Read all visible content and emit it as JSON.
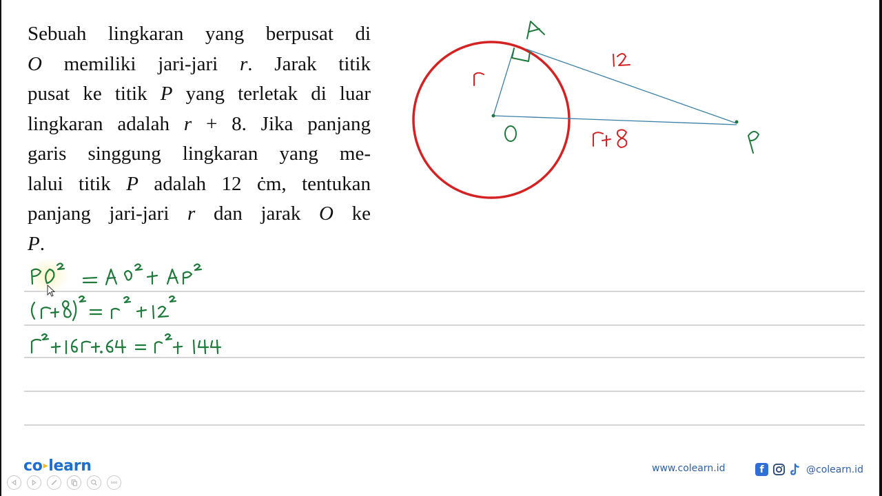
{
  "problem": {
    "lines": [
      "Sebuah lingkaran yang berpusat di",
      [
        "O",
        " memiliki jari-jari ",
        "r",
        ". Jarak titik"
      ],
      [
        "pusat ke titik ",
        "P",
        " yang terletak di luar"
      ],
      [
        "lingkaran adalah ",
        "r",
        " + 8. Jika panjang"
      ],
      "garis singgung lingkaran yang me-",
      [
        "lalui titik ",
        "P",
        " adalah 12 ċm, tentukan"
      ],
      [
        "panjang jari-jari ",
        "r",
        " dan jarak ",
        "O",
        " ke"
      ],
      [
        "P",
        "."
      ]
    ]
  },
  "diagram": {
    "points": {
      "A": "A",
      "O": "O",
      "P": "P"
    },
    "labels": {
      "radius": "r",
      "tangent": "12",
      "distance": "r+8"
    },
    "colors": {
      "circle": "#d42222",
      "lines": "#3a7fa8",
      "point_labels": "#1e7a3a",
      "measure_labels": "#d42222"
    }
  },
  "work": {
    "ink_color": "#1e7a3a",
    "lines": [
      "PO² = AO² + AP²",
      "(r+8)² = r² + 12²",
      "r² + 16r + 64 = r² + 144"
    ]
  },
  "footer": {
    "logo_left": "co",
    "logo_right": "learn",
    "controls": [
      "previous-icon",
      "next-icon",
      "pen-icon",
      "pages-icon",
      "zoom-icon",
      "more-icon"
    ],
    "website": "www.colearn.id",
    "social_handle": "@colearn.id",
    "social_icons": [
      "facebook-icon",
      "instagram-icon",
      "tiktok-icon"
    ]
  }
}
